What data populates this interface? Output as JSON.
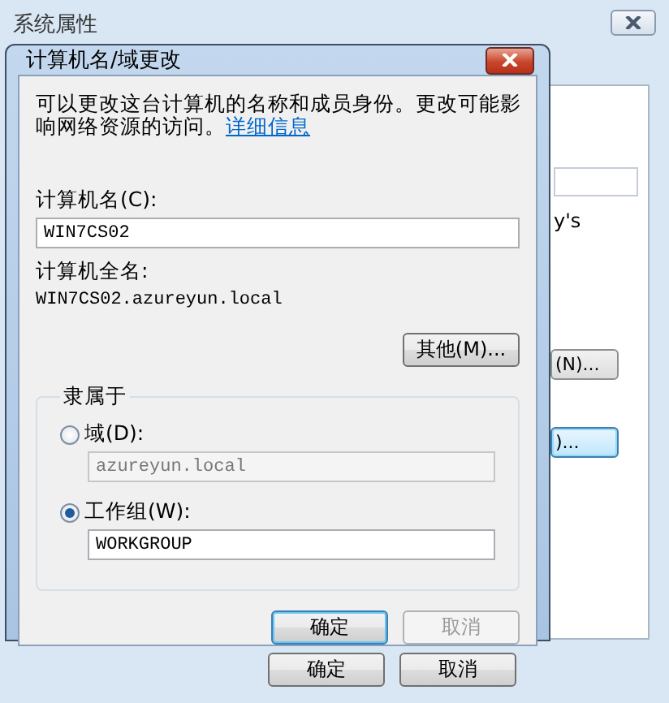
{
  "back_window": {
    "title": "系统属性",
    "panel_text": "y's",
    "panel_buttons": [
      {
        "label": "(N)...",
        "focused": false
      },
      {
        "label": ")...",
        "focused": true
      }
    ],
    "buttons": [
      {
        "label": "确定"
      },
      {
        "label": "取消"
      }
    ]
  },
  "dialog": {
    "title": "计算机名/域更改",
    "description": "可以更改这台计算机的名称和成员身份。更改可能影响网络资源的访问。",
    "link": "详细信息",
    "computer_name_label": "计算机名(C):",
    "computer_name": "WIN7CS02",
    "full_name_label": "计算机全名:",
    "full_name": "WIN7CS02.azureyun.local",
    "more_button": "其他(M)...",
    "member_of": {
      "title": "隶属于",
      "options": [
        {
          "label": "域(D):",
          "selected": false,
          "value": "azureyun.local"
        },
        {
          "label": "工作组(W):",
          "selected": true,
          "value": "WORKGROUP"
        }
      ]
    },
    "buttons": [
      {
        "label": "确定",
        "default": true,
        "disabled": false
      },
      {
        "label": "取消",
        "default": false,
        "disabled": true
      }
    ]
  }
}
